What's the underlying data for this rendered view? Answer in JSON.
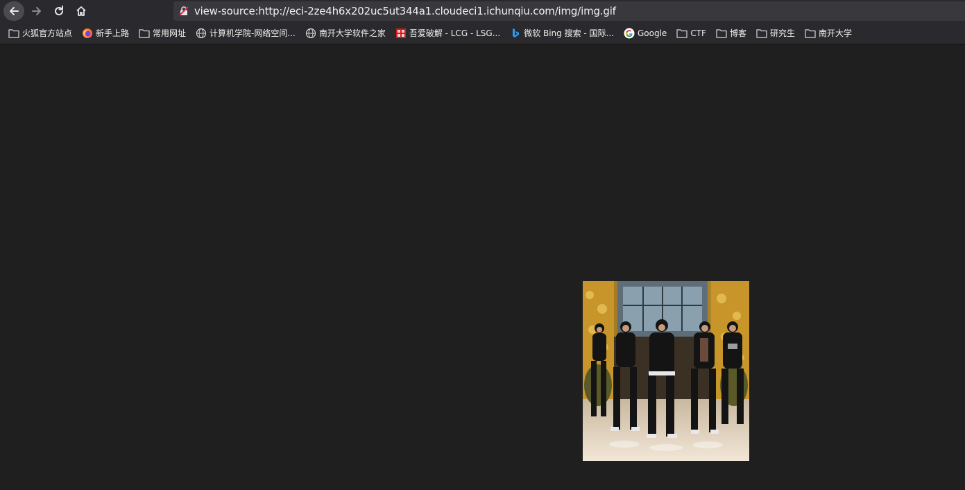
{
  "toolbar": {
    "back_icon": "arrow-left-icon",
    "forward_icon": "arrow-right-icon",
    "reload_icon": "reload-icon",
    "home_icon": "home-icon",
    "url": "view-source:http://eci-2ze4h6x202uc5ut344a1.cloudeci1.ichunqiu.com/img/img.gif"
  },
  "bookmarks": [
    {
      "label": "火狐官方站点",
      "icon": "folder-icon"
    },
    {
      "label": "新手上路",
      "icon": "firefox-icon"
    },
    {
      "label": "常用网址",
      "icon": "folder-icon"
    },
    {
      "label": "计算机学院-网络空间...",
      "icon": "globe-icon"
    },
    {
      "label": "南开大学软件之家",
      "icon": "globe-icon"
    },
    {
      "label": "吾爱破解 - LCG - LSG...",
      "icon": "52pojie-icon"
    },
    {
      "label": "微软 Bing 搜索 - 国际...",
      "icon": "bing-icon"
    },
    {
      "label": "Google",
      "icon": "google-icon"
    },
    {
      "label": "CTF",
      "icon": "folder-icon"
    },
    {
      "label": "博客",
      "icon": "folder-icon"
    },
    {
      "label": "研究生",
      "icon": "folder-icon"
    },
    {
      "label": "南开大学",
      "icon": "folder-icon"
    }
  ],
  "content": {
    "image_name": "dancing-group-gif"
  },
  "colors": {
    "page_bg": "#1f1f1f",
    "toolbar_bg": "#2a2a2e",
    "urlbar_bg": "#38383d"
  }
}
